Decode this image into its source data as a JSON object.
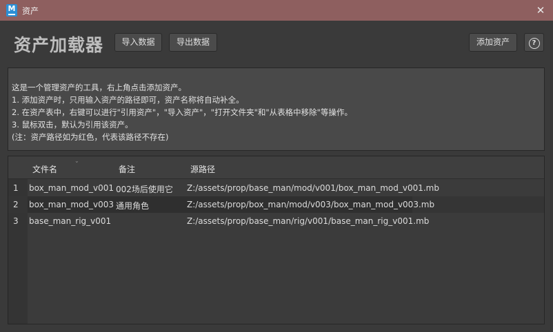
{
  "window": {
    "icon_letter": "M",
    "title": "资产",
    "close": "✕"
  },
  "header": {
    "title": "资产加载器",
    "import_label": "导入数据",
    "export_label": "导出数据",
    "add_asset_label": "添加资产",
    "help_label": "?"
  },
  "info": {
    "lines": [
      "这是一个管理资产的工具，右上角点击添加资产。",
      "1. 添加资产时，只用输入资产的路径即可，资产名称将自动补全。",
      "2. 在资产表中，右键可以进行\"引用资产\"，\"导入资产\"，\"打开文件夹\"和\"从表格中移除\"等操作。",
      "3. 鼠标双击，默认为引用该资产。",
      "(注：资产路径如为红色，代表该路径不存在)"
    ]
  },
  "table": {
    "columns": [
      "文件名",
      "备注",
      "源路径"
    ],
    "sort_icon": "⌄",
    "rows": [
      {
        "index": "1",
        "name": "box_man_mod_v001",
        "note": "002场后使用它",
        "path": "Z:/assets/prop/base_man/mod/v001/box_man_mod_v001.mb"
      },
      {
        "index": "2",
        "name": "box_man_mod_v003",
        "note": "通用角色",
        "path": "Z:/assets/prop/box_man/mod/v003/box_man_mod_v003.mb"
      },
      {
        "index": "3",
        "name": "base_man_rig_v001",
        "note": "",
        "path": "Z:/assets/prop/base_man/rig/v001/base_man_rig_v001.mb"
      }
    ]
  }
}
